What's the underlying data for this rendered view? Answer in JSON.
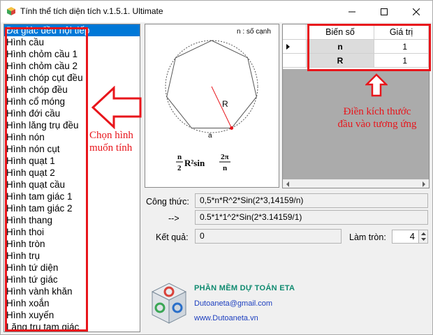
{
  "window": {
    "title": "Tính thể tích diện tích v.1.5.1. Ultimate",
    "minimize_glyph": "—",
    "maximize_glyph": "☐",
    "close_glyph": "✕"
  },
  "shapes": [
    "Đa giác đều nội tiếp",
    "Hình cầu",
    "Hình chỏm cầu 1",
    "Hình chỏm cầu 2",
    "Hình chóp cụt đều",
    "Hình chóp đều",
    "Hình cổ móng",
    "Hình đới cầu",
    "Hình lăng trụ đều",
    "Hình nón",
    "Hình nón cụt",
    "Hình quạt 1",
    "Hình quạt 2",
    "Hình quạt cầu",
    "Hình tam giác 1",
    "Hình tam giác 2",
    "Hình thang",
    "Hình thoi",
    "Hình tròn",
    "Hình trụ",
    "Hình tứ diện",
    "Hình tứ giác",
    "Hình vành khăn",
    "Hình xoắn",
    "Hình xuyến",
    "Lăng trụ tam giác"
  ],
  "selected_index": 0,
  "figure": {
    "note": "n : số cạnh",
    "radius_label": "R",
    "side_label": "a",
    "formula_n": "n",
    "formula_2": "2",
    "formula_mid": "R²sin",
    "formula_2pi": "2π",
    "formula_den": "n"
  },
  "grid": {
    "col_name": "Biến số",
    "col_value": "Giá trị",
    "rows": [
      {
        "name": "n",
        "value": "1"
      },
      {
        "name": "R",
        "value": "1"
      }
    ]
  },
  "annotations": {
    "choose_line1": "Chọn hình",
    "choose_line2": "muốn tính",
    "input_line1": "Điền kích thước",
    "input_line2": "đầu vào tương ứng"
  },
  "formula": {
    "label": "Công thức:",
    "value": "0,5*n*R^2*Sin(2*3,14159/n)",
    "arrow_label": "-->",
    "substituted": "0.5*1*1^2*Sin(2*3.14159/1)"
  },
  "result": {
    "label": "Kết quả:",
    "value": "0",
    "round_label": "Làm tròn:",
    "round_value": "4"
  },
  "brand": {
    "name": "PHẦN MỀM DỰ TOÁN ETA",
    "email": "Dutoaneta@gmail.com",
    "website": "www.Dutoaneta.vn"
  },
  "colors": {
    "accent_red": "#e8151b",
    "selection_blue": "#0078d7",
    "brand_green": "#0e8a6f",
    "brand_blue": "#1d3fbf"
  }
}
